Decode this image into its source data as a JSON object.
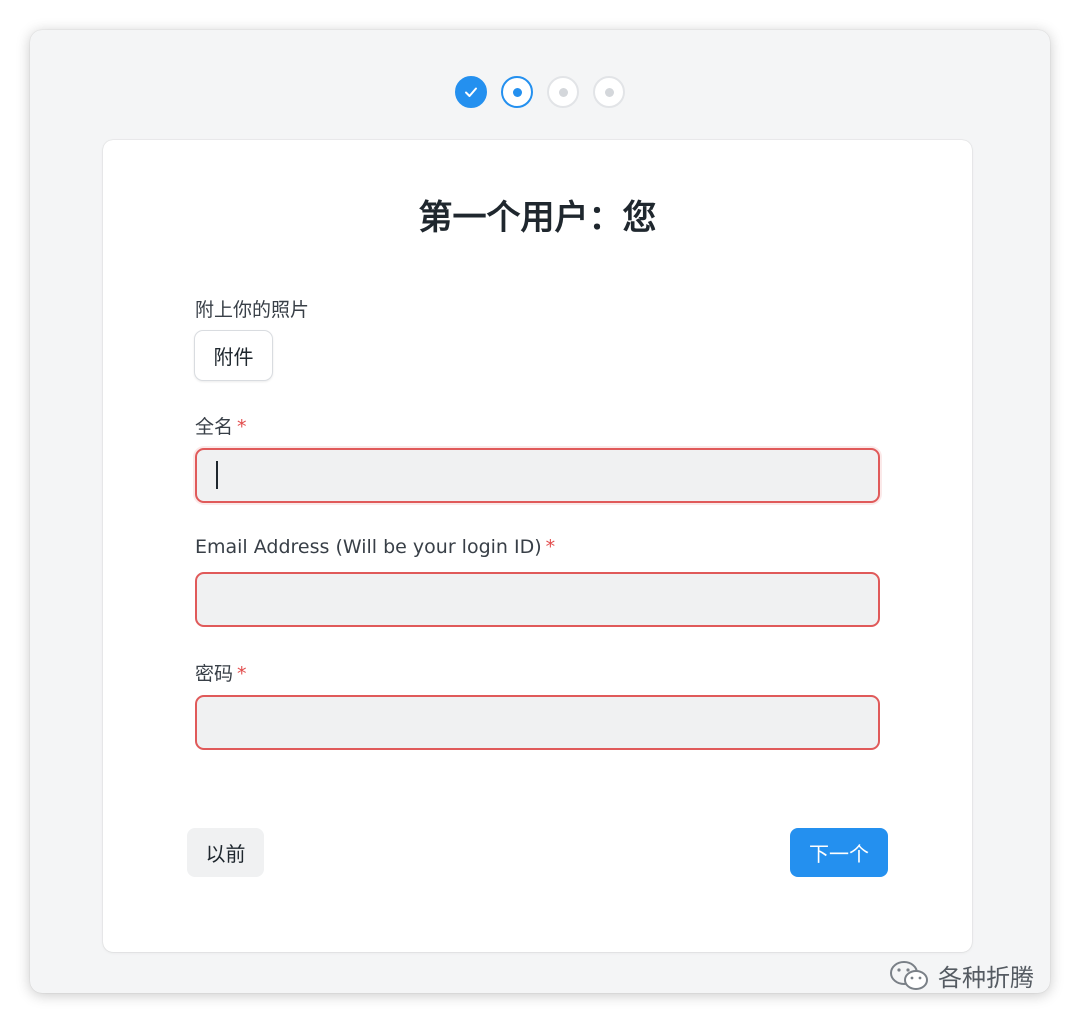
{
  "stepper": {
    "steps": [
      {
        "state": "done"
      },
      {
        "state": "current"
      },
      {
        "state": "pending"
      },
      {
        "state": "pending"
      }
    ]
  },
  "form": {
    "title": "第一个用户：您",
    "photo": {
      "label": "附上你的照片",
      "button_label": "附件"
    },
    "full_name": {
      "label": "全名",
      "required_mark": "*",
      "value": ""
    },
    "email": {
      "label": "Email Address (Will be your login ID)",
      "required_mark": "*",
      "value": ""
    },
    "password": {
      "label": "密码",
      "required_mark": "*",
      "value": ""
    },
    "prev_label": "以前",
    "next_label": "下一个"
  },
  "watermark": {
    "text": "各种折腾",
    "icon": "wechat-icon"
  },
  "colors": {
    "accent": "#2490ef",
    "error": "#e24c4c",
    "field_bg": "#f0f1f2",
    "window_bg": "#f4f5f6"
  }
}
